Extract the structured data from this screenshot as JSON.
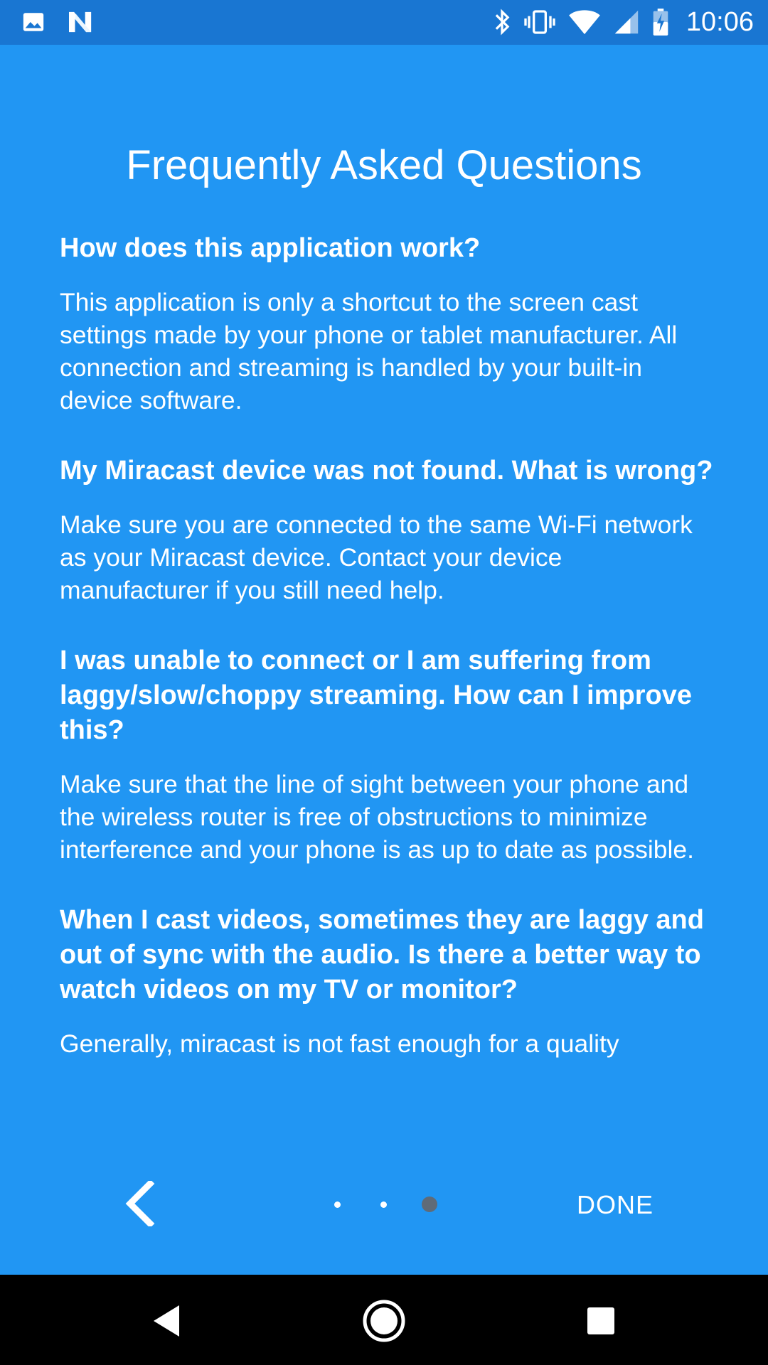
{
  "status_bar": {
    "left_icons": [
      "image-icon",
      "n-logo-icon"
    ],
    "right_icons": [
      "bluetooth-icon",
      "vibrate-icon",
      "wifi-icon",
      "cell-signal-icon",
      "battery-charging-icon"
    ],
    "time": "10:06",
    "background_color": "#1976D2"
  },
  "page": {
    "title": "Frequently Asked Questions",
    "background_color": "#2196F3"
  },
  "faq": [
    {
      "question": "How does this application work?",
      "answer": "This application is only a shortcut to the screen cast settings made by your phone or tablet manufacturer. All connection and streaming is handled by your built-in device software."
    },
    {
      "question": "My Miracast device was not found. What is wrong?",
      "answer": "Make sure you are connected to the same Wi-Fi network as your Miracast device. Contact your device manufacturer if you still need help."
    },
    {
      "question": "I was unable to connect or I am suffering from laggy/slow/choppy streaming. How can I improve this?",
      "answer": "Make sure that the line of sight between your phone and the wireless router is free of obstructions to minimize interference and your phone is as up to date as possible."
    },
    {
      "question": "When I cast videos, sometimes they are laggy and out of sync with the audio. Is there a better way to watch videos on my TV or monitor?",
      "answer": "Generally, miracast is not fast enough for a quality"
    }
  ],
  "pager": {
    "back_icon": "chevron-left-icon",
    "page_count": 3,
    "current_page": 3,
    "done_label": "DONE",
    "active_dot_color": "#5F6B78",
    "inactive_dot_color": "#FFFFFF"
  },
  "nav_bar": {
    "buttons": [
      "back-triangle-icon",
      "home-circle-icon",
      "recents-square-icon"
    ]
  }
}
